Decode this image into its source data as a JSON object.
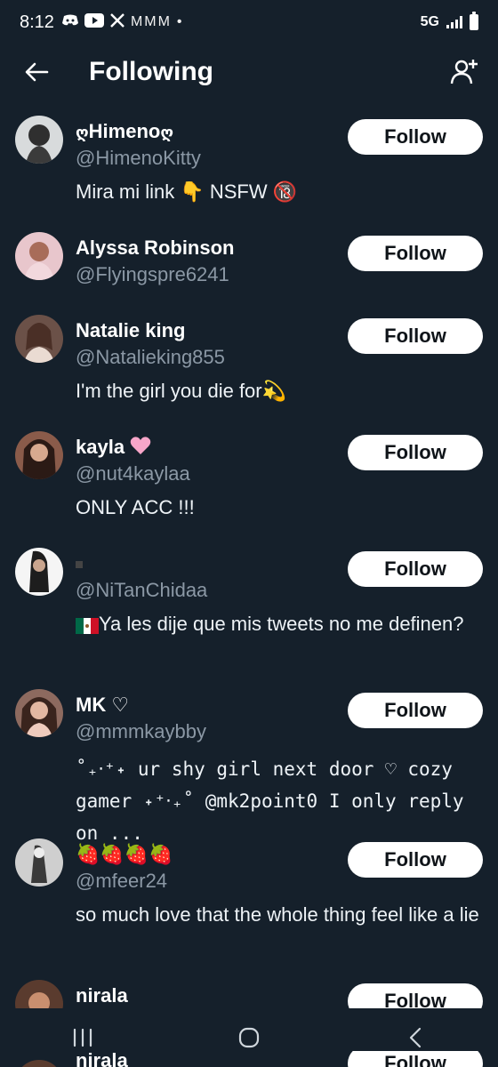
{
  "status": {
    "time": "8:12",
    "network": "5G",
    "notif_letters": "MMM",
    "notif_dot": "•"
  },
  "header": {
    "title": "Following"
  },
  "follow_label": "Follow",
  "rows": [
    {
      "name": "Himeno",
      "handle": "@HimenoKitty",
      "bio": "Mira mi link 👇 NSFW 🔞"
    },
    {
      "name": "Alyssa Robinson",
      "handle": "@Flyingspre6241",
      "bio": ""
    },
    {
      "name": "Natalie king",
      "handle": "@Natalieking855",
      "bio": "I'm the girl you die for💫"
    },
    {
      "name": "kayla",
      "handle": "@nut4kaylaa",
      "bio": "ONLY ACC !!!"
    },
    {
      "name": "",
      "handle": "@NiTanChidaa",
      "bio": "Ya les dije que mis tweets no me definen?"
    },
    {
      "name": "MK ♡",
      "handle": "@mmmkaybby",
      "bio": "˚₊‧⁺˖ ur shy girl next door ♡ cozy gamer ˖⁺‧₊˚ @mk2point0 I only reply on ..."
    },
    {
      "name": "🍓🍓🍓🍓",
      "handle": "@mfeer24",
      "bio": "so much love that the whole thing feel like a lie"
    },
    {
      "name": "nirala",
      "handle": "",
      "bio": ""
    }
  ],
  "peek_row": {
    "name": "nirala",
    "button": "Follow"
  },
  "icons": {
    "back": "back-arrow-icon",
    "add_user": "add-user-icon",
    "nav_recent": "recent-apps-icon",
    "nav_home": "home-icon",
    "nav_back": "back-icon"
  },
  "colors": {
    "background": "#15202b",
    "handle": "#8b98a5",
    "button": "#ffffff"
  }
}
